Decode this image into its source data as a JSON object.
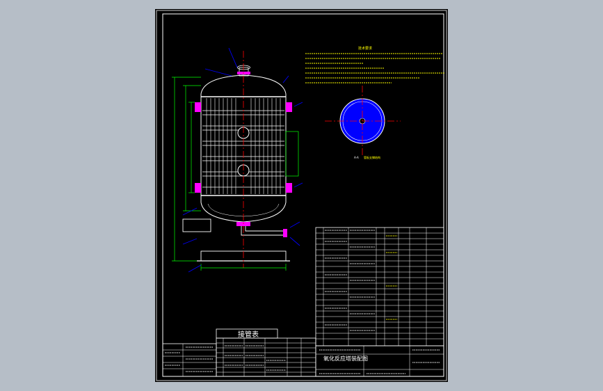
{
  "drawing": {
    "title_block_name": "氧化反应塔装配图",
    "nozzle_table_title": "接管表",
    "section_label": "A-A",
    "section_caption": "管板支撑结构",
    "tech_req_title": "技术要求",
    "colors": {
      "background": "#b6bec7",
      "sheet": "#000000",
      "border": "#ffffff",
      "vessel": "#ffffff",
      "dimension": "#00ff00",
      "leader": "#0000ff",
      "centerline": "#ff0000",
      "nozzle": "#ff00ff",
      "section_fill": "#0000ff",
      "accent_text": "#ffff00",
      "annotation": "#00ffff"
    }
  }
}
